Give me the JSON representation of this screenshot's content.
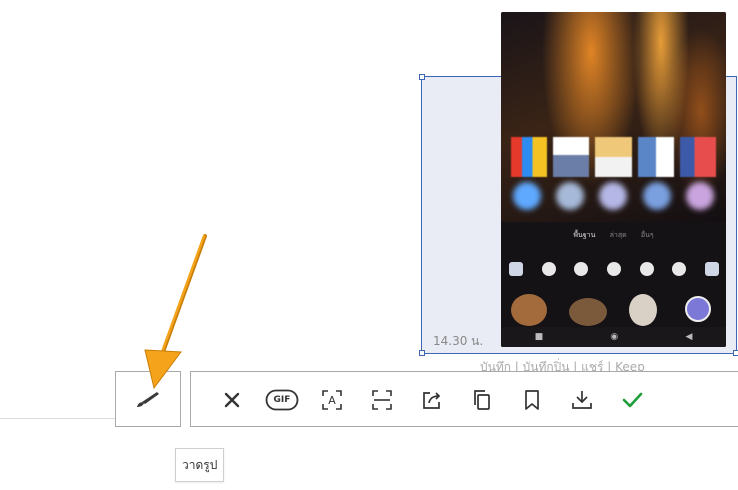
{
  "selection": {
    "timestamp": "14.30 น.",
    "faded_caption": "บันทึก | บันทึกปิ่น | แชร์ | Keep"
  },
  "phone": {
    "sheet_tabs": [
      "พื้นฐาน",
      "ล่าสุด",
      "อื่นๆ"
    ]
  },
  "draw_tool": {
    "icon": "paintbrush-icon",
    "tooltip": "วาดรูป"
  },
  "toolbar": {
    "items": [
      {
        "icon": "close-icon"
      },
      {
        "icon": "gif-icon",
        "label": "GIF"
      },
      {
        "icon": "text-recognition-icon",
        "label": "A"
      },
      {
        "icon": "scroll-capture-icon"
      },
      {
        "icon": "share-icon"
      },
      {
        "icon": "copy-icon"
      },
      {
        "icon": "bookmark-icon"
      },
      {
        "icon": "download-icon"
      },
      {
        "icon": "check-icon"
      }
    ]
  },
  "colors": {
    "selection_border": "#3d66b5",
    "selection_fill": "#e9ecf5",
    "confirm_green": "#1f9d3a",
    "arrow_orange": "#f5a31a",
    "toolbar_icon": "#333333"
  }
}
